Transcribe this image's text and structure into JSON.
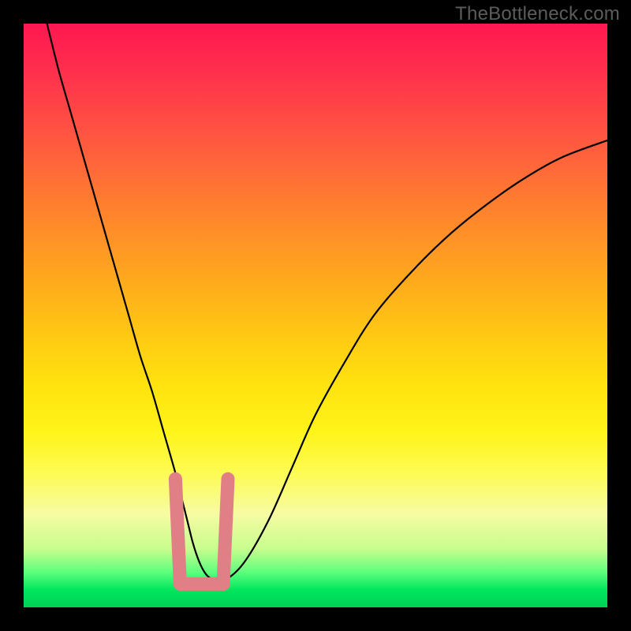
{
  "watermark": "TheBottleneck.com",
  "chart_data": {
    "type": "line",
    "title": "",
    "xlabel": "",
    "ylabel": "",
    "xlim": [
      0,
      100
    ],
    "ylim": [
      0,
      100
    ],
    "series": [
      {
        "name": "bottleneck-curve",
        "x": [
          4,
          6,
          8,
          10,
          12,
          14,
          16,
          18,
          20,
          22,
          24,
          26,
          27,
          28,
          29,
          30,
          31,
          32,
          33,
          35,
          38,
          42,
          46,
          50,
          55,
          60,
          66,
          72,
          78,
          85,
          92,
          100
        ],
        "values": [
          100,
          92,
          85,
          78,
          71,
          64,
          57,
          50,
          43,
          37,
          30,
          23,
          19,
          15,
          11,
          8,
          6,
          5,
          5,
          5,
          8,
          15,
          24,
          33,
          42,
          50,
          57,
          63,
          68,
          73,
          77,
          80
        ]
      }
    ],
    "highlight_band": {
      "name": "optimal-region",
      "x_range": [
        26,
        35
      ],
      "y_range": [
        4,
        22
      ],
      "color": "#e07f86"
    },
    "minimum_point": {
      "x": 31,
      "y": 5
    }
  },
  "colors": {
    "frame": "#000000",
    "curve": "#000000",
    "highlight": "#e07f86",
    "watermark": "#5c5c5c"
  }
}
